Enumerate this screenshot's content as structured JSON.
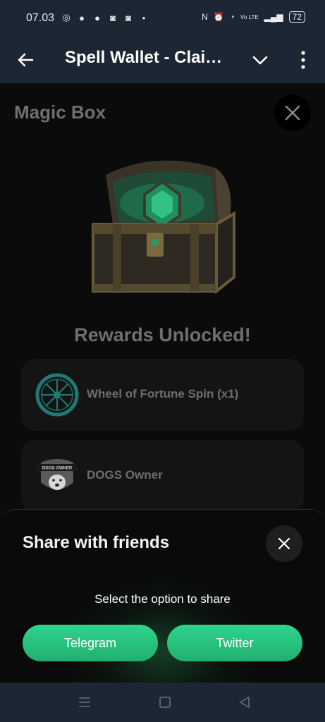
{
  "status_bar": {
    "time": "07.03",
    "left_icons": [
      "whatsapp-icon",
      "facebook-icon",
      "facebook-icon",
      "discord-icon",
      "discord-icon",
      "dot-icon"
    ],
    "network_label": "Vo LTE",
    "battery": "72"
  },
  "header": {
    "title": "Spell Wallet - Clai…"
  },
  "main": {
    "title": "Magic Box",
    "rewards_title": "Rewards Unlocked!",
    "rewards": [
      {
        "label": "Wheel of Fortune Spin (x1)",
        "icon": "wheel-icon"
      },
      {
        "label": "DOGS Owner",
        "icon": "dogs-badge-icon",
        "badge_text": "DOGS OWNER"
      }
    ]
  },
  "share": {
    "title": "Share with friends",
    "subtitle": "Select the option to share",
    "telegram_label": "Telegram",
    "twitter_label": "Twitter"
  },
  "colors": {
    "accent": "#2fd48c",
    "header_bg": "#1d2633"
  }
}
